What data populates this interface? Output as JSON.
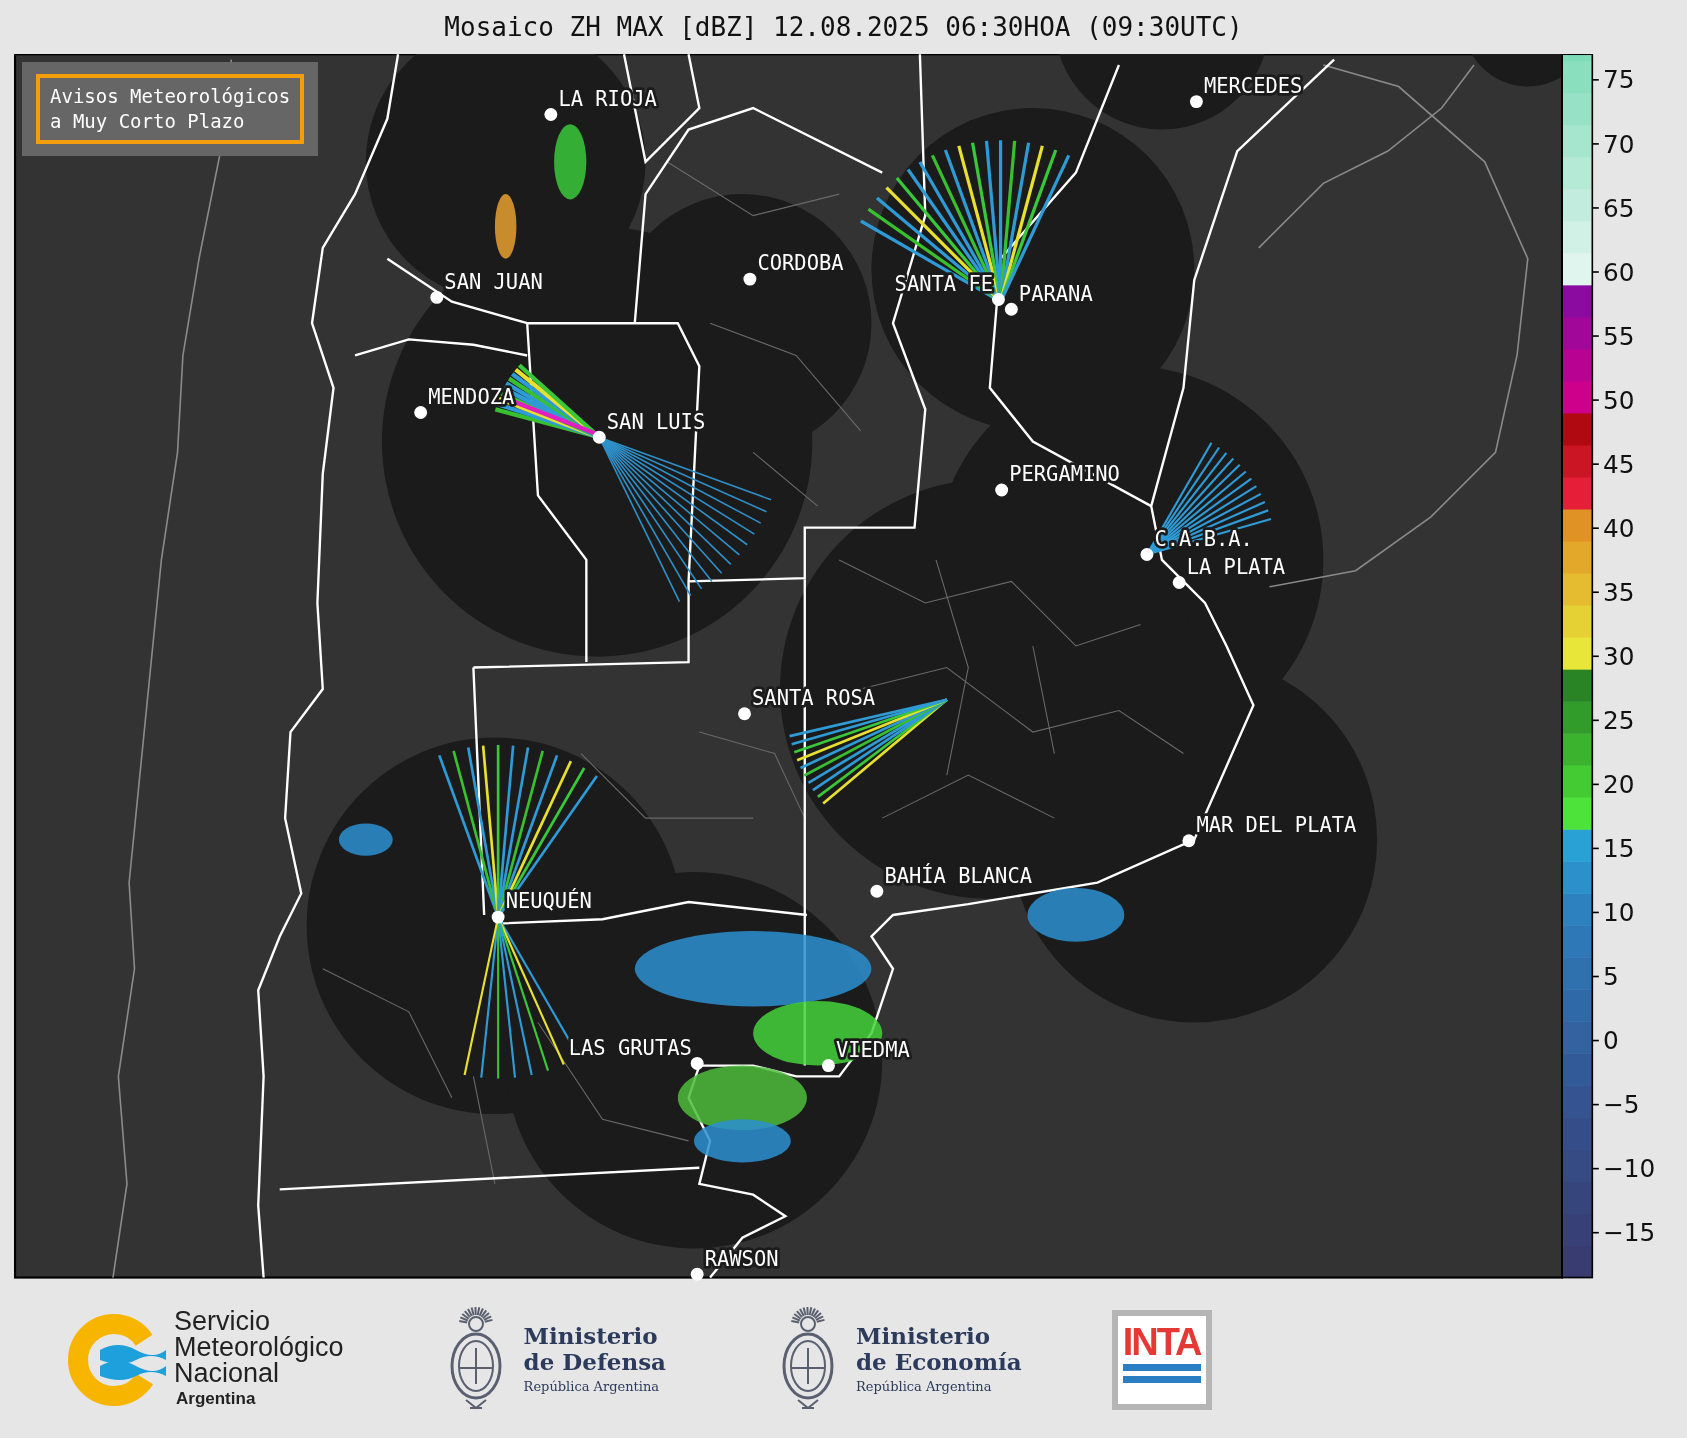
{
  "title": "Mosaico ZH MAX [dBZ] 12.08.2025 06:30HOA (09:30UTC)",
  "notice_box": {
    "lines": [
      "Avisos Meteorológicos",
      "a Muy Corto Plazo"
    ]
  },
  "cities": [
    {
      "name": "LA RIOJA"
    },
    {
      "name": "MERCEDES"
    },
    {
      "name": "SAN JUAN"
    },
    {
      "name": "CORDOBA"
    },
    {
      "name": "SANTA FE"
    },
    {
      "name": "PARANA"
    },
    {
      "name": "MENDOZA"
    },
    {
      "name": "SAN LUIS"
    },
    {
      "name": "PERGAMINO"
    },
    {
      "name": "C.A.B.A."
    },
    {
      "name": "LA PLATA"
    },
    {
      "name": "SANTA ROSA"
    },
    {
      "name": "MAR DEL PLATA"
    },
    {
      "name": "BAHÍA BLANCA"
    },
    {
      "name": "NEUQUÉN"
    },
    {
      "name": "LAS GRUTAS"
    },
    {
      "name": "VIEDMA"
    },
    {
      "name": "RAWSON"
    }
  ],
  "colorbar": {
    "ticks": [
      "75",
      "70",
      "65",
      "60",
      "55",
      "50",
      "45",
      "40",
      "35",
      "30",
      "25",
      "20",
      "15",
      "10",
      "5",
      "0",
      "−5",
      "−10",
      "−15"
    ]
  },
  "footer": {
    "logos": [
      {
        "kind": "smn",
        "lines": [
          "Servicio",
          "Meteorológico",
          "Nacional"
        ],
        "subtitle": "Argentina"
      },
      {
        "kind": "ministry",
        "lines": [
          "Ministerio",
          "de Defensa"
        ],
        "subtitle": "República Argentina"
      },
      {
        "kind": "ministry",
        "lines": [
          "Ministerio",
          "de Economía"
        ],
        "subtitle": "República Argentina"
      },
      {
        "kind": "inta",
        "text": "INTA"
      }
    ]
  }
}
